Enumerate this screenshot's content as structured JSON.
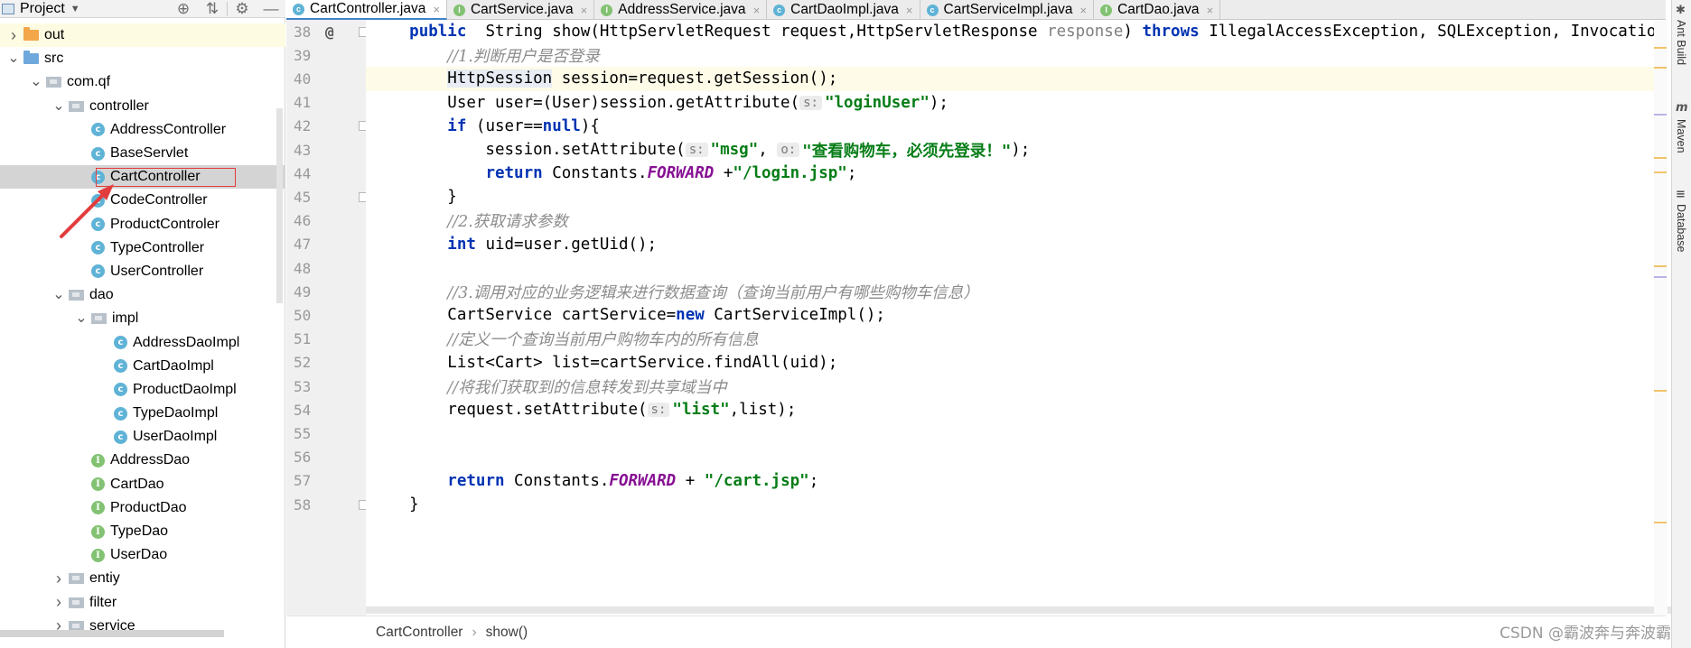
{
  "project_panel": {
    "title": "Project",
    "tools": [
      "target-icon",
      "collapse-icon",
      "gear-icon",
      "minimize-icon"
    ]
  },
  "tree": [
    {
      "label": "out",
      "depth": 0,
      "arrow": "right",
      "icon": "folder-orange"
    },
    {
      "label": "src",
      "depth": 0,
      "arrow": "down",
      "icon": "folder-blue"
    },
    {
      "label": "com.qf",
      "depth": 1,
      "arrow": "down",
      "icon": "package"
    },
    {
      "label": "controller",
      "depth": 2,
      "arrow": "down",
      "icon": "package"
    },
    {
      "label": "AddressController",
      "depth": 3,
      "arrow": "none",
      "icon": "class"
    },
    {
      "label": "BaseServlet",
      "depth": 3,
      "arrow": "none",
      "icon": "class"
    },
    {
      "label": "CartController",
      "depth": 3,
      "arrow": "none",
      "icon": "class",
      "selected": true
    },
    {
      "label": "CodeController",
      "depth": 3,
      "arrow": "none",
      "icon": "class"
    },
    {
      "label": "ProductControler",
      "depth": 3,
      "arrow": "none",
      "icon": "class"
    },
    {
      "label": "TypeController",
      "depth": 3,
      "arrow": "none",
      "icon": "class"
    },
    {
      "label": "UserController",
      "depth": 3,
      "arrow": "none",
      "icon": "class"
    },
    {
      "label": "dao",
      "depth": 2,
      "arrow": "down",
      "icon": "package"
    },
    {
      "label": "impl",
      "depth": 3,
      "arrow": "down",
      "icon": "package"
    },
    {
      "label": "AddressDaoImpl",
      "depth": 4,
      "arrow": "none",
      "icon": "class"
    },
    {
      "label": "CartDaoImpl",
      "depth": 4,
      "arrow": "none",
      "icon": "class"
    },
    {
      "label": "ProductDaoImpl",
      "depth": 4,
      "arrow": "none",
      "icon": "class"
    },
    {
      "label": "TypeDaoImpl",
      "depth": 4,
      "arrow": "none",
      "icon": "class"
    },
    {
      "label": "UserDaoImpl",
      "depth": 4,
      "arrow": "none",
      "icon": "class"
    },
    {
      "label": "AddressDao",
      "depth": 3,
      "arrow": "none",
      "icon": "interface"
    },
    {
      "label": "CartDao",
      "depth": 3,
      "arrow": "none",
      "icon": "interface"
    },
    {
      "label": "ProductDao",
      "depth": 3,
      "arrow": "none",
      "icon": "interface"
    },
    {
      "label": "TypeDao",
      "depth": 3,
      "arrow": "none",
      "icon": "interface"
    },
    {
      "label": "UserDao",
      "depth": 3,
      "arrow": "none",
      "icon": "interface"
    },
    {
      "label": "entiy",
      "depth": 2,
      "arrow": "right",
      "icon": "package"
    },
    {
      "label": "filter",
      "depth": 2,
      "arrow": "right",
      "icon": "package"
    },
    {
      "label": "service",
      "depth": 2,
      "arrow": "right",
      "icon": "package"
    }
  ],
  "tabs": [
    {
      "label": "CartController.java",
      "kind": "c",
      "active": true
    },
    {
      "label": "CartService.java",
      "kind": "i",
      "active": false
    },
    {
      "label": "AddressService.java",
      "kind": "i",
      "active": false
    },
    {
      "label": "CartDaoImpl.java",
      "kind": "c",
      "active": false
    },
    {
      "label": "CartServiceImpl.java",
      "kind": "c",
      "active": false
    },
    {
      "label": "CartDao.java",
      "kind": "i",
      "active": false
    }
  ],
  "tab_close_glyph": "×",
  "code": {
    "line_numbers": [
      "38",
      "39",
      "40",
      "41",
      "42",
      "43",
      "44",
      "45",
      "46",
      "47",
      "48",
      "49",
      "50",
      "51",
      "52",
      "53",
      "54",
      "55",
      "56",
      "57",
      "58"
    ],
    "current_line": "40",
    "lines": [
      [
        [
          "t",
          "    "
        ],
        [
          "kw",
          "public"
        ],
        [
          "t",
          "  String show(HttpServletRequest request,HttpServletResponse "
        ],
        [
          "param",
          "response"
        ],
        [
          "t",
          ") "
        ],
        [
          "kw",
          "throws"
        ],
        [
          "t",
          " IllegalAccessException, SQLException, InvocationTargetException {"
        ]
      ],
      [
        [
          "t",
          "        "
        ],
        [
          "cmt",
          "//1.判断用户是否登录"
        ]
      ],
      [
        [
          "t",
          "        "
        ],
        [
          "hl",
          "HttpSession"
        ],
        [
          "t",
          " session=request.getSession();"
        ]
      ],
      [
        [
          "t",
          "        User user=(User)session.getAttribute("
        ],
        [
          "hint",
          "s:"
        ],
        [
          "str",
          "\"loginUser\""
        ],
        [
          "t",
          ");"
        ]
      ],
      [
        [
          "t",
          "        "
        ],
        [
          "kw",
          "if"
        ],
        [
          "t",
          " (user=="
        ],
        [
          "kw",
          "null"
        ],
        [
          "t",
          "){"
        ]
      ],
      [
        [
          "t",
          "            session.setAttribute("
        ],
        [
          "hint",
          "s:"
        ],
        [
          "str",
          "\"msg\""
        ],
        [
          "t",
          ", "
        ],
        [
          "hint",
          "o:"
        ],
        [
          "str",
          "\"查看购物车，必须先登录！\""
        ],
        [
          "t",
          ");"
        ]
      ],
      [
        [
          "t",
          "            "
        ],
        [
          "kw",
          "return"
        ],
        [
          "t",
          " Constants."
        ],
        [
          "static",
          "FORWARD"
        ],
        [
          "t",
          " +"
        ],
        [
          "str",
          "\"/login.jsp\""
        ],
        [
          "t",
          ";"
        ]
      ],
      [
        [
          "t",
          "        }"
        ]
      ],
      [
        [
          "t",
          "        "
        ],
        [
          "cmt",
          "//2.获取请求参数"
        ]
      ],
      [
        [
          "t",
          "        "
        ],
        [
          "kw",
          "int"
        ],
        [
          "t",
          " uid=user.getUid();"
        ]
      ],
      [
        [
          "t",
          ""
        ]
      ],
      [
        [
          "t",
          "        "
        ],
        [
          "cmt",
          "//3.调用对应的业务逻辑来进行数据查询（查询当前用户有哪些购物车信息）"
        ]
      ],
      [
        [
          "t",
          "        CartService cartService="
        ],
        [
          "kw",
          "new"
        ],
        [
          "t",
          " CartServiceImpl();"
        ]
      ],
      [
        [
          "t",
          "        "
        ],
        [
          "cmt",
          "//定义一个查询当前用户购物车内的所有信息"
        ]
      ],
      [
        [
          "t",
          "        List<Cart> list=cartService.findAll(uid);"
        ]
      ],
      [
        [
          "t",
          "        "
        ],
        [
          "cmt",
          "//将我们获取到的信息转发到共享域当中"
        ]
      ],
      [
        [
          "t",
          "        request.setAttribute("
        ],
        [
          "hint",
          "s:"
        ],
        [
          "str",
          "\"list\""
        ],
        [
          "t",
          ",list);"
        ]
      ],
      [
        [
          "t",
          ""
        ]
      ],
      [
        [
          "t",
          ""
        ]
      ],
      [
        [
          "t",
          "        "
        ],
        [
          "kw",
          "return"
        ],
        [
          "t",
          " Constants."
        ],
        [
          "static",
          "FORWARD"
        ],
        [
          "t",
          " + "
        ],
        [
          "str",
          "\"/cart.jsp\""
        ],
        [
          "t",
          ";"
        ]
      ],
      [
        [
          "t",
          "    }"
        ]
      ]
    ]
  },
  "breadcrumb": {
    "class_name": "CartController",
    "separator": "›",
    "method": "show()"
  },
  "right_strip": {
    "labels": [
      "Ant Build",
      "Maven",
      "Database"
    ],
    "icons": [
      "ant-icon",
      "maven-icon",
      "database-icon"
    ]
  },
  "watermark": "CSDN @霸波奔与奔波霸",
  "colors": {
    "keyword": "#0033b3",
    "string": "#067d17",
    "comment": "#8c8c8c",
    "static_field": "#871094",
    "annotation_box": "#e33c3c",
    "active_tab_underline": "#4083c9"
  }
}
